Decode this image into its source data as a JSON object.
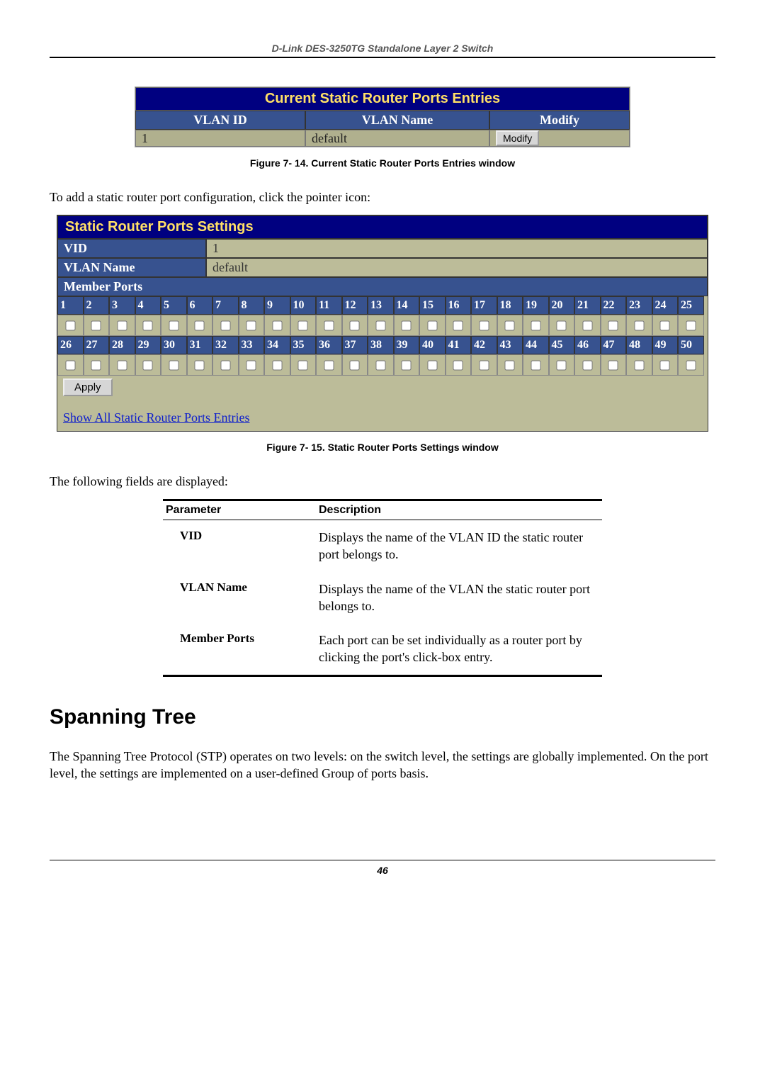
{
  "header": "D-Link DES-3250TG Standalone Layer 2 Switch",
  "fig14": {
    "title": "Current Static Router Ports Entries",
    "cols": {
      "vlanid": "VLAN ID",
      "vlanname": "VLAN Name",
      "modify": "Modify"
    },
    "row": {
      "vlanid": "1",
      "vlanname": "default",
      "modify_btn": "Modify"
    },
    "caption": "Figure 7- 14.  Current Static Router Ports Entries window"
  },
  "intro1": "To add a static router port configuration, click the pointer icon:",
  "fig15": {
    "title": "Static Router Ports Settings",
    "vid_label": "VID",
    "vid_value": "1",
    "vlan_label": "VLAN Name",
    "vlan_value": "default",
    "member_label": "Member Ports",
    "ports_row1": [
      "1",
      "2",
      "3",
      "4",
      "5",
      "6",
      "7",
      "8",
      "9",
      "10",
      "11",
      "12",
      "13",
      "14",
      "15",
      "16",
      "17",
      "18",
      "19",
      "20",
      "21",
      "22",
      "23",
      "24",
      "25"
    ],
    "ports_row2": [
      "26",
      "27",
      "28",
      "29",
      "30",
      "31",
      "32",
      "33",
      "34",
      "35",
      "36",
      "37",
      "38",
      "39",
      "40",
      "41",
      "42",
      "43",
      "44",
      "45",
      "46",
      "47",
      "48",
      "49",
      "50"
    ],
    "apply_btn": "Apply",
    "show_link": "Show All Static Router Ports Entries",
    "caption": "Figure 7- 15.  Static Router Ports Settings window"
  },
  "intro2": "The following fields are displayed:",
  "params": {
    "col1": "Parameter",
    "col2": "Description",
    "rows": [
      {
        "p": "VID",
        "d": "Displays the name of the VLAN ID the static router port belongs to."
      },
      {
        "p": "VLAN Name",
        "d": "Displays the name of the VLAN the static router port belongs to."
      },
      {
        "p": "Member Ports",
        "d": "Each port can be set individually as a router port by clicking the port's click-box entry."
      }
    ]
  },
  "spt": {
    "heading": "Spanning Tree",
    "para": "The Spanning Tree Protocol (STP) operates on two levels: on the switch level, the settings are globally implemented. On the port level, the settings are implemented on a user-defined Group of ports basis."
  },
  "page_number": "46"
}
